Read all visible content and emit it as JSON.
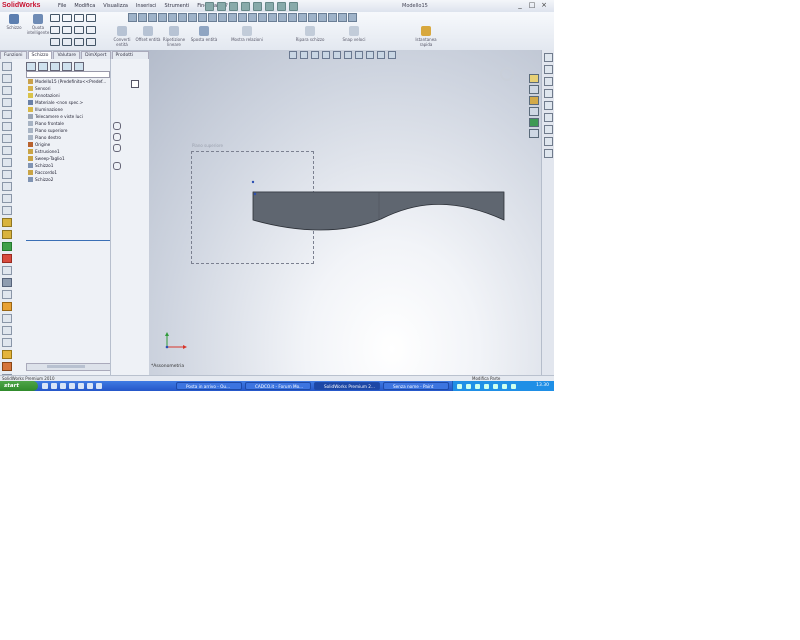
{
  "window": {
    "brand": "SolidWorks",
    "menus": [
      "File",
      "Modifica",
      "Visualizza",
      "Inserisci",
      "Strumenti",
      "Finestra",
      "?"
    ],
    "document_title": "Modello15",
    "buttons": [
      "_",
      "□",
      "×"
    ]
  },
  "toolbar": {
    "sketch_label": "Schizzo",
    "smart_dim_label": "Quota intelligente",
    "cmd1": "Converti entità",
    "cmd2": "Offset entità",
    "cmd3": "Ripetizione lineare",
    "cmd4": "Sposta entità",
    "cmd5": "Mostra relazioni",
    "cmd6": "Ripara schizzo",
    "cmd7": "Snap veloci",
    "cmd8": "Istantanea rapida"
  },
  "tabs": [
    "Funzioni",
    "Schizzo",
    "Valutare",
    "DimXpert",
    "Prodotti Office"
  ],
  "tree": {
    "items": [
      "Modello15 (Predefinito<<Predef...",
      "Sensori",
      "Annotazioni",
      "Materiale <non spec.>",
      "Illuminazione",
      "Telecamere e viste luci",
      "Piano frontale",
      "Piano superiore",
      "Piano destro",
      "Origine",
      "Estrusione1",
      "Sweep-Taglio1",
      "Schizzo1",
      "Raccordo1",
      "Schizzo2"
    ]
  },
  "viewport": {
    "dash_label": "Piano superiore",
    "status_label": "*Assonometria"
  },
  "statusbar": {
    "left": "SolidWorks Premium 2010",
    "right": "Modifica Parte"
  },
  "taskbar": {
    "start": "start",
    "tasks": [
      "Posta in arrivo - Ou...",
      "CADCO.it - Forum Mo...",
      "SolidWorks Premium 2...",
      "Senza nome - Paint"
    ],
    "clock": "13.30"
  },
  "colors": {
    "part_fill": "#5f6670",
    "part_edge": "#2b2f36",
    "brand_red": "#c8102e",
    "taskbar_blue": "#2456c8"
  }
}
